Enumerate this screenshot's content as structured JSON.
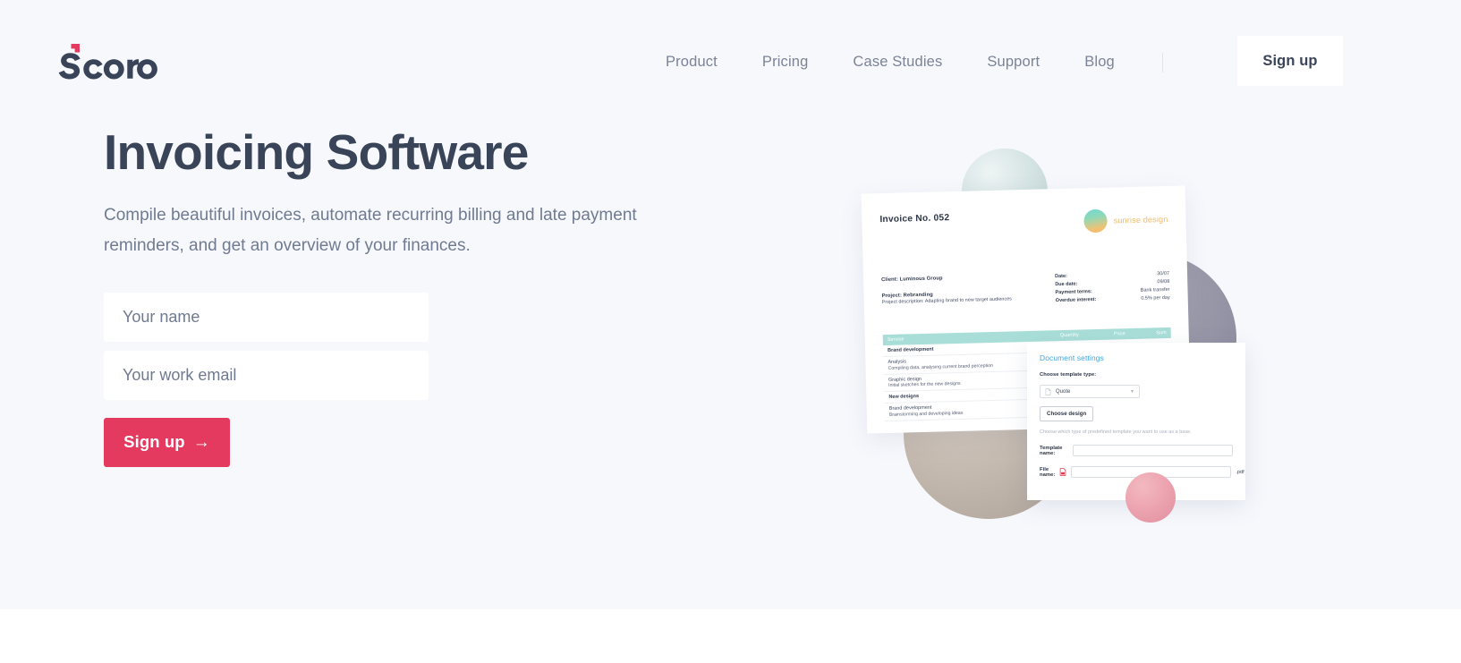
{
  "brand": {
    "name": "Scoro",
    "accent_red": "#e43a5f",
    "text_dark": "#3a4458"
  },
  "header": {
    "nav": [
      {
        "label": "Product"
      },
      {
        "label": "Pricing"
      },
      {
        "label": "Case Studies"
      },
      {
        "label": "Support"
      },
      {
        "label": "Blog"
      }
    ],
    "signup_label": "Sign up"
  },
  "hero": {
    "headline": "Invoicing Software",
    "subhead": "Compile beautiful invoices, automate recurring billing and late payment reminders, and get an overview of your finances.",
    "name_placeholder": "Your name",
    "email_placeholder": "Your work email",
    "cta_label": "Sign up",
    "cta_arrow": "→"
  },
  "invoice": {
    "title": "Invoice No. 052",
    "brand_name": "sunrise design",
    "client_line": "Client: Luminous Group",
    "project_line": "Project: Rebranding",
    "project_desc": "Project description: Adapting brand to new target audiences",
    "meta": [
      {
        "key": "Date:",
        "value": "30/07"
      },
      {
        "key": "Due date:",
        "value": "09/08"
      },
      {
        "key": "Payment terms:",
        "value": "Bank transfer"
      },
      {
        "key": "Overdue interest:",
        "value": "0.5% per day"
      }
    ],
    "columns": [
      "Service",
      "Quantity",
      "Price",
      "Sum"
    ],
    "rows": [
      {
        "title": "Brand development",
        "bold": true,
        "desc": ""
      },
      {
        "title": "Analysis",
        "bold": false,
        "desc": "Compiling data, analysing current brand perception"
      },
      {
        "title": "Graphic design",
        "bold": false,
        "desc": "Initial sketches for the new designs"
      },
      {
        "title": "New designs",
        "bold": true,
        "desc": ""
      },
      {
        "title": "Brand development",
        "bold": false,
        "desc": "Brainstorming and developing ideas"
      }
    ]
  },
  "settings": {
    "title": "Document settings",
    "template_type_label": "Choose template type:",
    "template_type_value": "Quote",
    "choose_design_label": "Choose design",
    "hint": "Choose which type of predefined template you want to use as a base.",
    "template_name_label": "Template name:",
    "template_name_value": "",
    "file_name_label": "File name:",
    "file_name_value": "",
    "file_extension": ".pdf"
  }
}
